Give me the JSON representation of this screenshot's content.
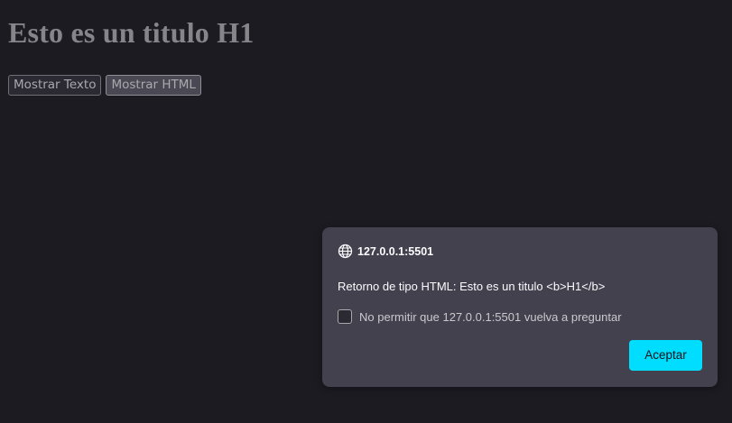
{
  "page": {
    "heading": "Esto es un titulo H1",
    "buttons": {
      "show_text": "Mostrar Texto",
      "show_html": "Mostrar HTML"
    }
  },
  "dialog": {
    "origin": "127.0.0.1:5501",
    "origin_icon": "globe-icon",
    "message": "Retorno de tipo HTML: Esto es un titulo <b>H1</b>",
    "checkbox_label": "No permitir que 127.0.0.1:5501 vuelva a preguntar",
    "checkbox_checked": false,
    "accept_label": "Aceptar"
  },
  "colors": {
    "page_background": "#1c1b22",
    "dialog_background": "#42414d",
    "accent": "#00ddff"
  }
}
